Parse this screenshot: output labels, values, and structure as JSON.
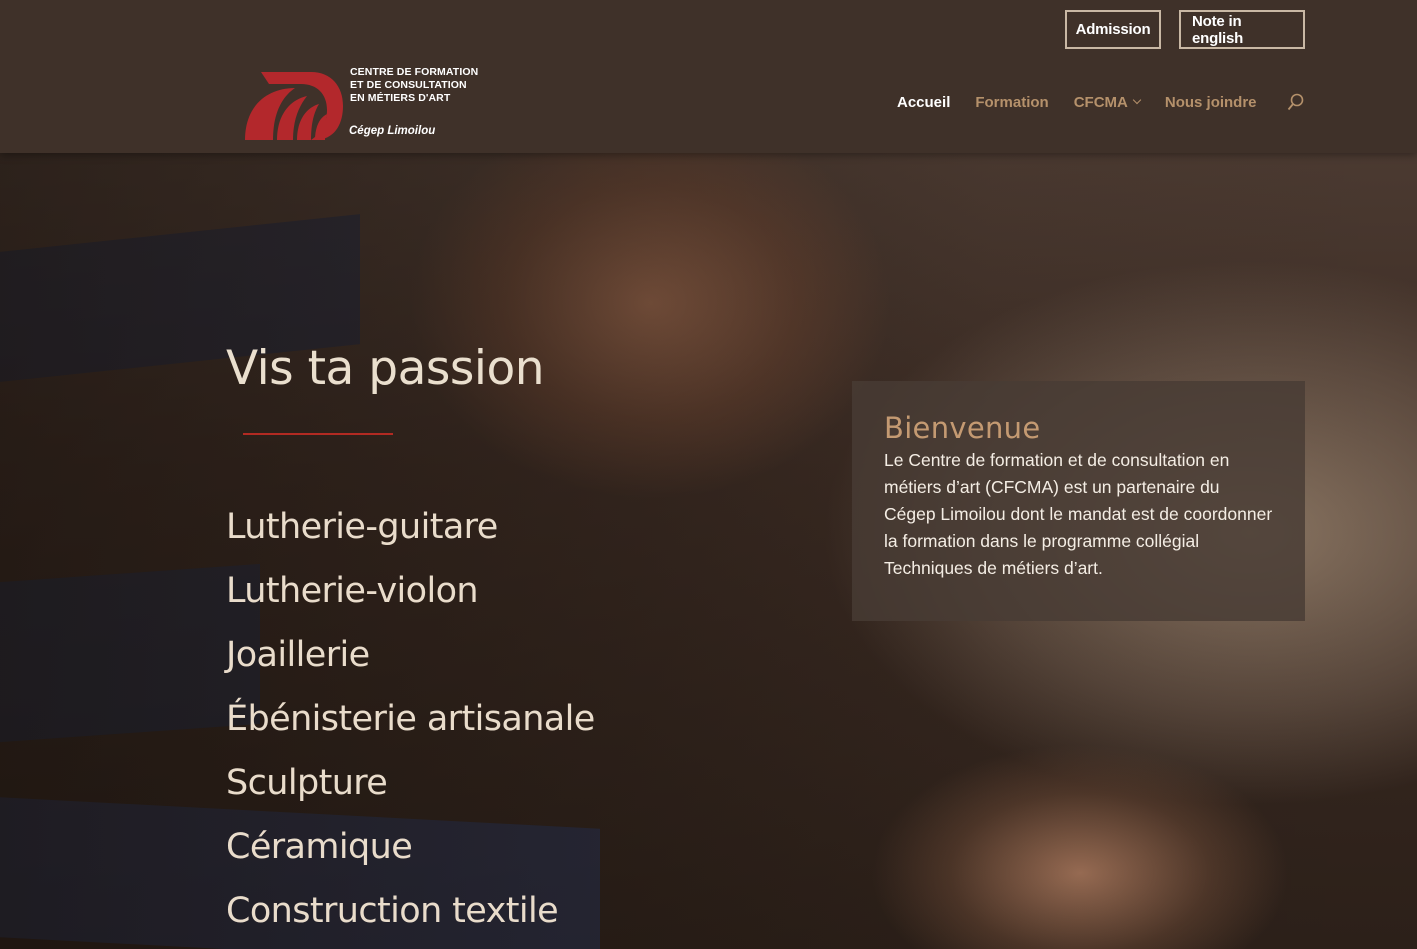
{
  "header": {
    "admission_label": "Admission",
    "english_label": "Note in english",
    "logo": {
      "line1": "CENTRE DE FORMATION",
      "line2": "ET DE CONSULTATION",
      "line3": "EN MÉTIERS D'ART",
      "subtitle": "Cégep Limoilou"
    },
    "nav": [
      {
        "label": "Accueil",
        "active": true
      },
      {
        "label": "Formation"
      },
      {
        "label": "CFCMA",
        "has_dropdown": true
      },
      {
        "label": "Nous joindre"
      }
    ],
    "search_icon": "search-icon"
  },
  "hero": {
    "title": "Vis ta passion",
    "programs": [
      "Lutherie-guitare",
      "Lutherie-violon",
      "Joaillerie",
      "Ébénisterie artisanale",
      "Sculpture",
      "Céramique",
      "Construction textile"
    ]
  },
  "welcome": {
    "title": "Bienvenue",
    "text": "Le Centre de formation et de consultation en métiers d’art (CFCMA) est un partenaire du Cégep Limoilou dont le mandat est de coordonner la formation dans le programme collégial Techniques de métiers d’art."
  },
  "colors": {
    "header_bg": "#3f3129",
    "nav_link": "#b5916b",
    "accent_red": "#b22a22",
    "logo_red": "#b3282c"
  }
}
